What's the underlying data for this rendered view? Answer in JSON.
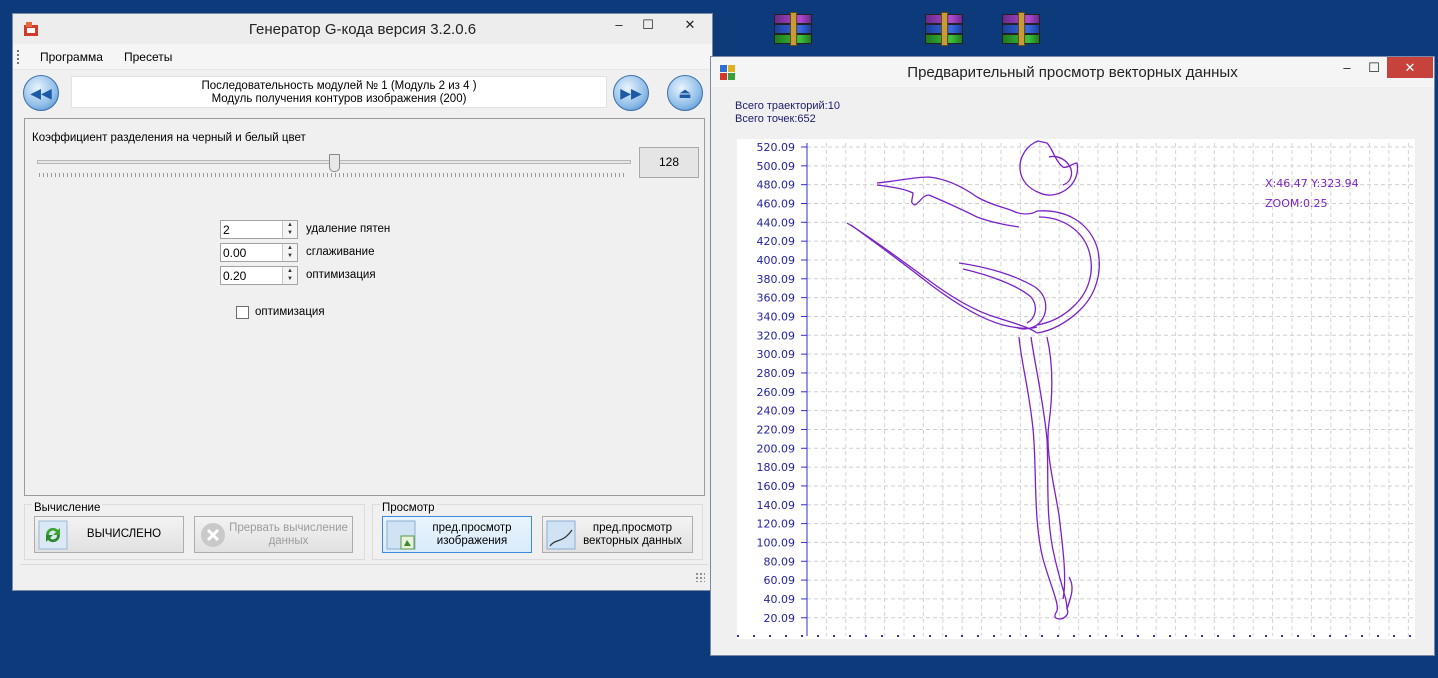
{
  "main_window": {
    "title": "Генератор G-кода версия 3.2.0.6",
    "menu": [
      "Программа",
      "Пресеты"
    ],
    "sequence_line1": "Последовательность модулей № 1 (Модуль 2 из 4 )",
    "sequence_line2": "Модуль получения контуров изображения (200)",
    "slider_label": "Коэффициент разделения на черный и белый цвет",
    "slider_value": "128",
    "slider_position": 0.5,
    "params": [
      {
        "value": "2",
        "label": "удаление пятен"
      },
      {
        "value": "0.00",
        "label": "сглаживание"
      },
      {
        "value": "0.20",
        "label": "оптимизация"
      }
    ],
    "checkbox_label": "оптимизация",
    "checkbox_checked": false,
    "group_calc": {
      "title": "Вычисление",
      "compute_label": "ВЫЧИСЛЕНО",
      "abort_label": "Прервать вычисление данных"
    },
    "group_view": {
      "title": "Просмотр",
      "preview_image_label": "пред.просмотр изображения",
      "preview_vector_label": "пред.просмотр векторных данных"
    }
  },
  "preview_window": {
    "title": "Предварительный просмотр векторных данных",
    "total_paths": "Всего траекторий:10",
    "total_points": "Всего точек:652",
    "cursor_readout": "X:46.47 Y:323.94",
    "zoom_readout": "ZOOM:0.25",
    "y_ticks": [
      "520.09",
      "500.09",
      "480.09",
      "460.09",
      "440.09",
      "420.09",
      "400.09",
      "380.09",
      "360.09",
      "340.09",
      "320.09",
      "300.09",
      "280.09",
      "260.09",
      "240.09",
      "220.09",
      "200.09",
      "180.09",
      "160.09",
      "140.09",
      "120.09",
      "100.09",
      "80.09",
      "60.09",
      "40.09",
      "20.09"
    ],
    "accent_color": "#7a22c8",
    "axis_text_color": "#1f1fa0"
  }
}
